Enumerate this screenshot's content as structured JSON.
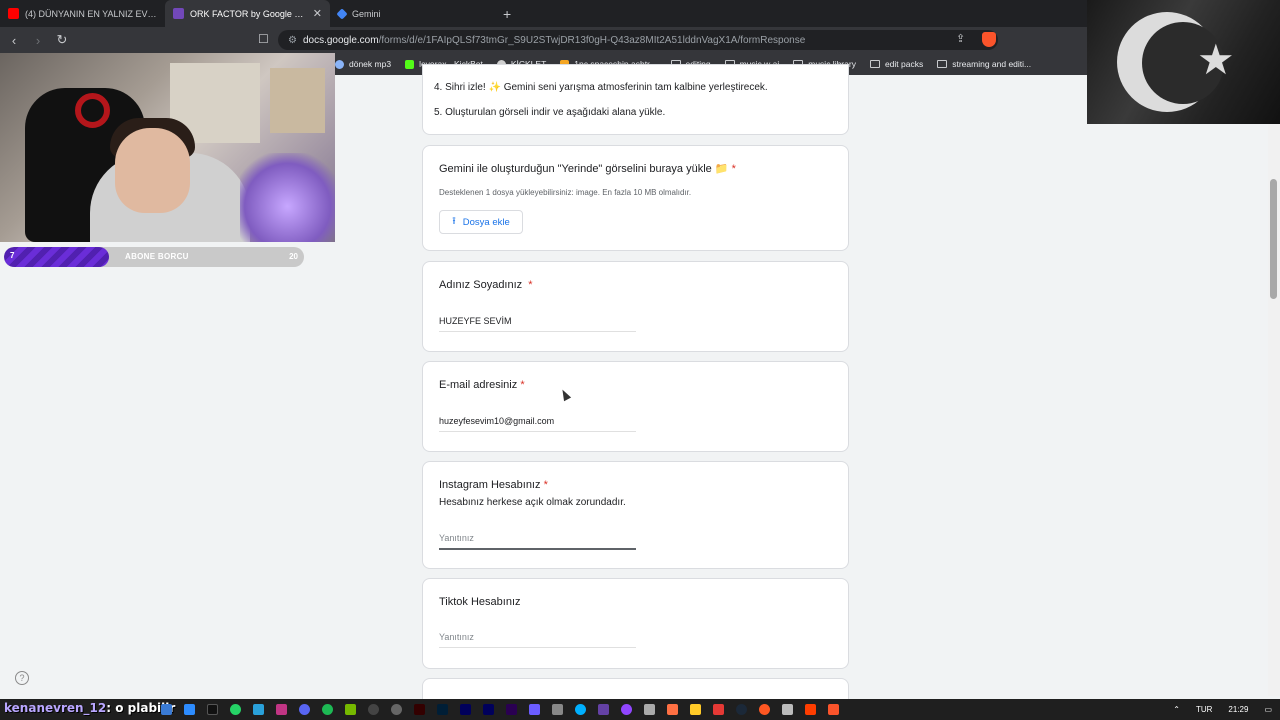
{
  "browser": {
    "tabs": [
      {
        "title": "(4) DÜNYANIN EN YALNIZ EVİNDE B",
        "fav_color": "#ff0000"
      },
      {
        "title": "ORK FACTOR by Google Gemini",
        "fav_color": "#7248b9"
      },
      {
        "title": "Gemini",
        "fav_color": "#4285f4"
      }
    ],
    "url_host": "docs.google.com",
    "url_path": "/forms/d/e/1FAIpQLSf73tmGr_S9U2STwjDR13f0gH-Q43az8MIt2A51lddnVagX1A/formResponse",
    "bookmarks": [
      {
        "label": "dönek mp3",
        "type": "site",
        "color": "#8ab4f8"
      },
      {
        "label": "levorax - KickBot",
        "type": "site",
        "color": "#53fc18"
      },
      {
        "label": "KİCKLET",
        "type": "site",
        "color": "#cfcfcf"
      },
      {
        "label": "1pc spaceship ashtr...",
        "type": "site",
        "color": "#f5a623"
      },
      {
        "label": "editing",
        "type": "folder"
      },
      {
        "label": "music w ai",
        "type": "folder"
      },
      {
        "label": "music library",
        "type": "folder"
      },
      {
        "label": "edit packs",
        "type": "folder"
      },
      {
        "label": "streaming and editi...",
        "type": "folder"
      }
    ]
  },
  "overlay": {
    "progress_left": "7",
    "progress_label": "ABONE BORCU",
    "progress_right": "20",
    "progress_fraction": 0.35
  },
  "form": {
    "instr_line4": "4. Sihri izle! ✨ Gemini seni yarışma atmosferinin tam kalbine yerleştirecek.",
    "instr_line5": "5. Oluşturulan görseli indir ve aşağıdaki alana yükle.",
    "upload": {
      "title": "Gemini ile oluşturduğun \"Yerinde\" görselini buraya yükle 📁",
      "hint": "Desteklenen 1 dosya yükleyebilirsiniz: image. En fazla 10 MB olmalıdır.",
      "button": "Dosya ekle"
    },
    "name": {
      "title": "Adınız Soyadınız",
      "value": "HUZEYFE SEVİM"
    },
    "email": {
      "title": "E-mail adresiniz",
      "value": "huzeyfesevim10@gmail.com"
    },
    "instagram": {
      "title": "Instagram Hesabınız",
      "desc": "Hesabınız herkese açık olmak zorundadır.",
      "placeholder": "Yanıtınız"
    },
    "tiktok": {
      "title": "Tiktok Hesabınız",
      "placeholder": "Yanıtınız"
    },
    "required_mark": "*"
  },
  "taskbar": {
    "chat_user": "kenanevren_12",
    "chat_text": ": o plabilir",
    "lang": "TUR",
    "time": "21:29"
  }
}
